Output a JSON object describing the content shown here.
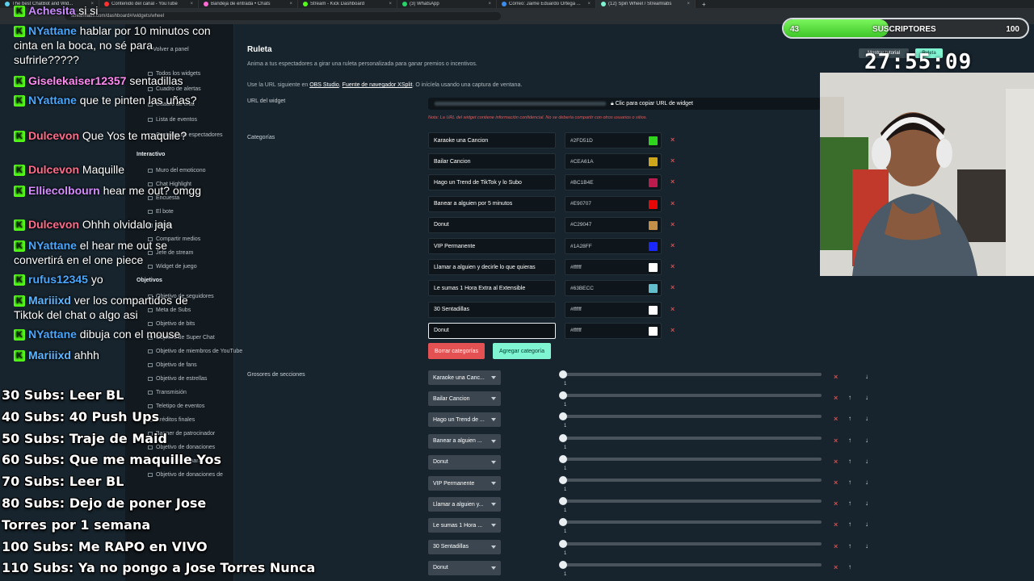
{
  "browser": {
    "tabs": [
      {
        "label": "The best ChatBot and Wid...",
        "color": "#5fd1f0"
      },
      {
        "label": "Contenido del canal - YouTube",
        "color": "#ff3131"
      },
      {
        "label": "Bandeja de entrada • Chats",
        "color": "#ff6ad5"
      },
      {
        "label": "Stream - Kick Dashboard",
        "color": "#53fc18"
      },
      {
        "label": "(3) WhatsApp",
        "color": "#25d366"
      },
      {
        "label": "Correo: Jaime Eduardo Ortega ...",
        "color": "#3b8ef0"
      },
      {
        "label": "(12) Spin Wheel / Streamlabs",
        "color": "#80f5d2"
      }
    ],
    "url": "streamlabs.com/dashboard#/widgets/wheel"
  },
  "sidebar": {
    "back_label": "Volver a panel",
    "items": [
      "Todos los widgets",
      "Cuadro de alertas",
      "Cuadro de chat",
      "Lista de eventos",
      "Contador de espectadores"
    ],
    "interactive_head": "Interactivo",
    "interactive_items": [
      "Muro del emoticono",
      "Chat Highlight",
      "Encuesta",
      "El bote",
      "Ruleta",
      "Compartir medios",
      "Jefe de stream",
      "Widget de juego"
    ],
    "goals_head": "Objetivos",
    "goal_items": [
      "Objetivo de seguidores",
      "Meta de Subs",
      "Objetivo de bits",
      "Objetivo de Super Chat",
      "Objetivo de miembros de YouTube",
      "Objetivo de fans",
      "Objetivo de estrellas",
      "Transmisión",
      "Teletipo de eventos",
      "Créditos finales",
      "Banner de patrocinador",
      "Objetivo de donaciones",
      "Streamlabs Charity",
      "Objetivo de donaciones de"
    ]
  },
  "page": {
    "title": "Ruleta",
    "description": "Anima a tus espectadores a girar una ruleta personalizada para ganar premios o incentivos.",
    "url_text_prefix": "Use la URL siguiente en",
    "obs_link": "OBS Studio",
    "sep": ",",
    "xsplit_link": "Fuente de navegador XSplit",
    "url_text_suffix": ". O inícíela usando una captura de ventana.",
    "url_label": "URL del widget",
    "copy_label": "Clic para copiar URL de widget",
    "warning": "Nota: La URL del widget contiene información confidencial. No se debería compartir con otros usuarios o sitios.",
    "categories_label": "Categorías",
    "remove_button": "Borrar categorías",
    "add_button": "Agregar categoría",
    "sections_label": "Grosores de secciones"
  },
  "categories": [
    {
      "name": "Karaoke una Cancion",
      "color": "#2FD51D"
    },
    {
      "name": "Bailar Cancion",
      "color": "#CEA61A"
    },
    {
      "name": "Hago un Trend de TikTok y lo Subo",
      "color": "#BC1B4E"
    },
    {
      "name": "Banear a alguien por 5 minutos",
      "color": "#E90707"
    },
    {
      "name": "Donut",
      "color": "#C29047"
    },
    {
      "name": "VIP Permanente",
      "color": "#1A28FF"
    },
    {
      "name": "Llamar a alguien y decirle lo que quieras",
      "color": "#ffffff"
    },
    {
      "name": "Le sumas 1 Hora Extra al Extensible",
      "color": "#63BECC"
    },
    {
      "name": "30 Sentadillas",
      "color": "#ffffff"
    },
    {
      "name": "Donut",
      "color": "#ffffff"
    }
  ],
  "sections": [
    {
      "label": "Karaoke una Canc...",
      "value": 1
    },
    {
      "label": "Bailar Cancion",
      "value": 1
    },
    {
      "label": "Hago un Trend de ...",
      "value": 1
    },
    {
      "label": "Banear a alguien ...",
      "value": 1
    },
    {
      "label": "Donut",
      "value": 1
    },
    {
      "label": "VIP Permanente",
      "value": 1
    },
    {
      "label": "Llamar a alguien y...",
      "value": 1
    },
    {
      "label": "Le sumas 1 Hora ...",
      "value": 1
    },
    {
      "label": "30 Sentadillas",
      "value": 1
    },
    {
      "label": "Donut",
      "value": 1
    }
  ],
  "chat": [
    {
      "user": "Achesita",
      "color": "#c98aff",
      "text": " si si"
    },
    {
      "user": "NYattane",
      "color": "#4aa7ff",
      "text": " hablar por 10 minutos con cinta en la boca, no sé para sufrirle?????"
    },
    {
      "user": "Giselekaiser12357",
      "color": "#ff8af2",
      "text": " sentadillas"
    },
    {
      "user": "NYattane",
      "color": "#4aa7ff",
      "text": " que te pinten las uñas?"
    },
    {
      "user": "Dulcevon",
      "color": "#ff6b8a",
      "text": " Que Yos te maquile?"
    },
    {
      "user": "Dulcevon",
      "color": "#ff6b8a",
      "text": " Maquille"
    },
    {
      "user": "Elliecolbourn",
      "color": "#d58cff",
      "text": " hear me out? omgg"
    },
    {
      "user": "Dulcevon",
      "color": "#ff6b8a",
      "text": " Ohhh olvidalo jaja"
    },
    {
      "user": "NYattane",
      "color": "#4aa7ff",
      "text": " el hear me out se convertirá en el one piece"
    },
    {
      "user": "rufus12345",
      "color": "#4aa7ff",
      "text": " yo"
    },
    {
      "user": "Mariiixd",
      "color": "#5fb6ff",
      "text": " ver los compartidos de Tiktok del chat o algo asi"
    },
    {
      "user": "NYattane",
      "color": "#4aa7ff",
      "text": " dibuja con el mouse"
    },
    {
      "user": "Mariiixd",
      "color": "#5fb6ff",
      "text": " ahhh"
    }
  ],
  "goals_list": [
    "30 Subs: Leer BL",
    "40 Subs: 40 Push Ups",
    "50 Subs: Traje de Maid",
    "60 Subs: Que me maquille Yos",
    "70 Subs: Leer BL",
    "80 Subs: Dejo de poner Jose",
    "Torres por 1 semana",
    "100 Subs: Me RAPO en VIVO",
    "110 Subs: Ya no pongo a Jose Torres Nunca"
  ],
  "sub_goal": {
    "current": "43",
    "label": "SUSCRIPTORES",
    "target": "100",
    "fraction": 0.43
  },
  "timer": "27:55:09",
  "overlay_buttons": {
    "tutorial": "Mostrar tutorial",
    "ruleta": "Ruleta"
  }
}
